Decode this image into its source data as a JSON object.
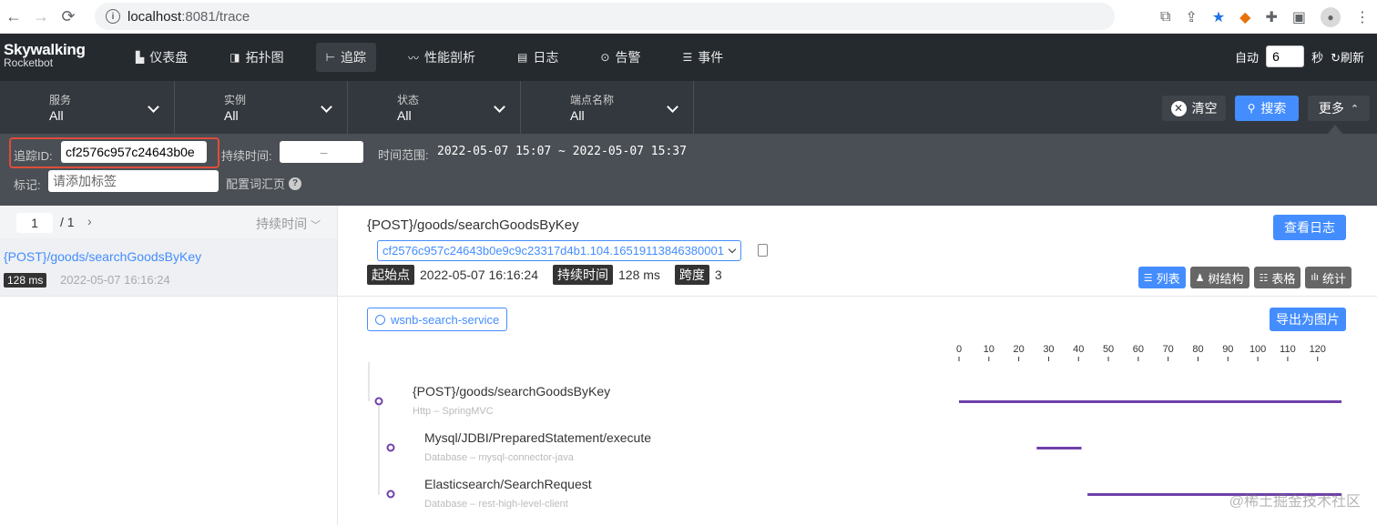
{
  "browser": {
    "url_host": "localhost",
    "url_path": ":8081/trace",
    "info_icon": "i"
  },
  "app": {
    "logo_line1": "Skywalking",
    "logo_line2": "Rocketbot",
    "nav": [
      {
        "label": "仪表盘",
        "icon": "dashboard-icon"
      },
      {
        "label": "拓扑图",
        "icon": "topology-icon"
      },
      {
        "label": "追踪",
        "icon": "trace-icon",
        "active": true
      },
      {
        "label": "性能剖析",
        "icon": "profile-icon"
      },
      {
        "label": "日志",
        "icon": "log-icon"
      },
      {
        "label": "告警",
        "icon": "alarm-icon"
      },
      {
        "label": "事件",
        "icon": "event-icon"
      }
    ],
    "auto_label": "自动",
    "auto_value": "6",
    "seconds_label": "秒",
    "refresh_label": "刷新"
  },
  "filters": {
    "service": {
      "label": "服务",
      "value": "All"
    },
    "instance": {
      "label": "实例",
      "value": "All"
    },
    "status": {
      "label": "状态",
      "value": "All"
    },
    "endpoint": {
      "label": "端点名称",
      "value": "All"
    },
    "clear_label": "清空",
    "search_label": "搜索",
    "more_label": "更多",
    "trace_id_label": "追踪ID:",
    "trace_id_value": "cf2576c957c24643b0e",
    "duration_label": "持续时间:",
    "duration_placeholder": "–",
    "time_range_label": "时间范围:",
    "time_range_value": "2022-05-07 15:07 ~ 2022-05-07 15:37",
    "tags_label": "标记:",
    "tags_placeholder": "请添加标签",
    "config_label": "配置词汇页",
    "help_icon": "?"
  },
  "list": {
    "page_current": "1",
    "page_total": "/ 1",
    "next": "›",
    "sort_label": "持续时间",
    "items": [
      {
        "title": "{POST}/goods/searchGoodsByKey",
        "duration": "128 ms",
        "time": "2022-05-07 16:16:24"
      }
    ]
  },
  "detail": {
    "title": "{POST}/goods/searchGoodsByKey",
    "view_log_label": "查看日志",
    "trace_id": "cf2576c957c24643b0e9c9c23317d4b1.104.16519113846380001",
    "start_label": "起始点",
    "start_value": "2022-05-07 16:16:24",
    "duration_label": "持续时间",
    "duration_value": "128 ms",
    "span_label": "跨度",
    "span_value": "3",
    "views": [
      {
        "label": "列表",
        "icon": "list-icon",
        "active": true
      },
      {
        "label": "树结构",
        "icon": "tree-icon"
      },
      {
        "label": "表格",
        "icon": "table-icon"
      },
      {
        "label": "统计",
        "icon": "stats-icon"
      }
    ],
    "service_tag": "wsnb-search-service",
    "export_label": "导出为图片",
    "axis_ticks": [
      "0",
      "10",
      "20",
      "30",
      "40",
      "50",
      "60",
      "70",
      "80",
      "90",
      "100",
      "110",
      "120"
    ],
    "axis_max": 128,
    "spans": [
      {
        "title": "{POST}/goods/searchGoodsByKey",
        "sub": "Http – SpringMVC",
        "start": 0,
        "end": 128,
        "depth": 0
      },
      {
        "title": "Mysql/JDBI/PreparedStatement/execute",
        "sub": "Database – mysql-connector-java",
        "start": 26,
        "end": 41,
        "depth": 1
      },
      {
        "title": "Elasticsearch/SearchRequest",
        "sub": "Database – rest-high-level-client",
        "start": 43,
        "end": 128,
        "depth": 1
      }
    ],
    "bar_color": "#6e40aa"
  },
  "watermark": "@稀土掘金技术社区"
}
